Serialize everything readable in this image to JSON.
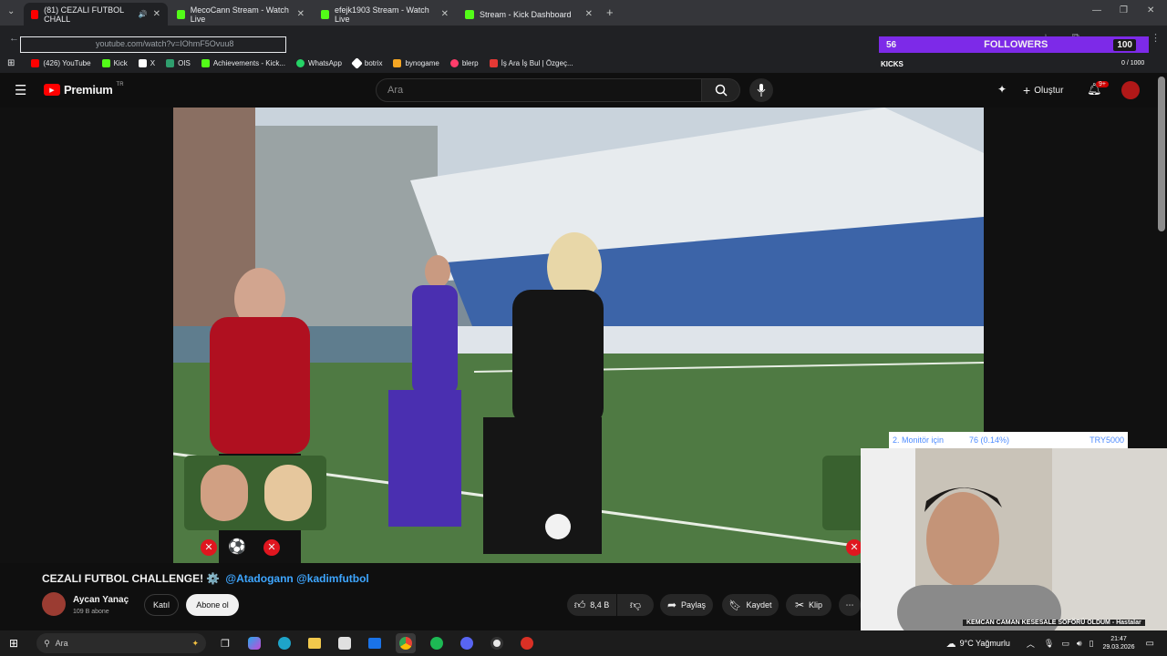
{
  "browser": {
    "tabs": [
      {
        "title": "(81) CEZALI FUTBOL CHALL",
        "active": true,
        "favicon": "#ff0000"
      },
      {
        "title": "MecoCann Stream - Watch Live",
        "active": false,
        "favicon": "#53fc18"
      },
      {
        "title": "efejk1903 Stream - Watch Live",
        "active": false,
        "favicon": "#53fc18"
      },
      {
        "title": "Stream - Kick Dashboard",
        "active": false,
        "favicon": "#53fc18"
      }
    ],
    "url": "youtube.com/watch?v=IOhmF5Ovuu8",
    "bookmarks": [
      {
        "label": "(426) YouTube",
        "color": "#ff0000"
      },
      {
        "label": "Kick",
        "color": "#53fc18"
      },
      {
        "label": "X",
        "color": "#ffffff"
      },
      {
        "label": "OIS",
        "color": "#2f9e6e"
      },
      {
        "label": "Achievements - Kick...",
        "color": "#53fc18"
      },
      {
        "label": "WhatsApp",
        "color": "#25d366"
      },
      {
        "label": "botrix",
        "color": "#ffffff"
      },
      {
        "label": "bynogame",
        "color": "#f5a623"
      },
      {
        "label": "blerp",
        "color": "#ff3d6b"
      },
      {
        "label": "İş Ara İş Bul | Özgeç...",
        "color": "#e53935"
      }
    ]
  },
  "youtube": {
    "logo_text": "Premium",
    "logo_sup": "TR",
    "search_placeholder": "Ara",
    "create_label": "Oluştur",
    "notif_badge": "9+",
    "video_title": "CEZALI FUTBOL CHALLENGE! ⚙️",
    "video_mentions": "@Atadogann @kadimfutbol",
    "channel_name": "Aycan Yanaç",
    "subscribers": "109 B abone",
    "join_label": "Katıl",
    "subscribe_label": "Abone ol",
    "likes": "8,4 B",
    "share_label": "Paylaş",
    "save_label": "Kaydet",
    "clip_label": "Klip"
  },
  "overlay": {
    "followers_count": "56",
    "followers_label": "FOLLOWERS",
    "followers_goal": "100",
    "kicks_label": "KICKS",
    "kicks_progress": "0 / 1000",
    "monitor_label": "2. Monitör için",
    "monitor_pct": "76 (0.14%)",
    "monitor_amount": "TRY5000",
    "ticker_text": "KEMCAN CAMAN KESESALE SOFÖRÜ OLDUM - Hastalar"
  },
  "taskbar": {
    "search_placeholder": "Ara",
    "weather": "9°C Yağmurlu",
    "time": "21:47",
    "date": "29.03.2026"
  }
}
